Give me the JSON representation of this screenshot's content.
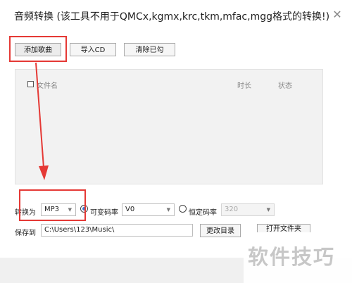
{
  "dialog": {
    "title": "音频转换 (该工具不用于QMCx,kgmx,krc,tkm,mfac,mgg格式的转换!)",
    "close_glyph": "✕"
  },
  "toolbar": {
    "add_song": "添加歌曲",
    "import_cd": "导入CD",
    "clear_checked": "清除已勾"
  },
  "file_list": {
    "columns": [
      "文件名",
      "时长",
      "状态"
    ]
  },
  "convert": {
    "label": "转换为",
    "format": "MP3",
    "vbr_label": "可变码率",
    "vbr_value": "V0",
    "cbr_label": "恒定码率",
    "cbr_value": "320"
  },
  "save": {
    "label": "保存到",
    "path": "C:\\Users\\123\\Music\\",
    "change_dir": "更改目录",
    "open_folder": "打开文件夹"
  },
  "watermark": "软件技巧",
  "colors": {
    "annotation_red": "#e53935",
    "radio_selected": "#3a7bd5"
  }
}
